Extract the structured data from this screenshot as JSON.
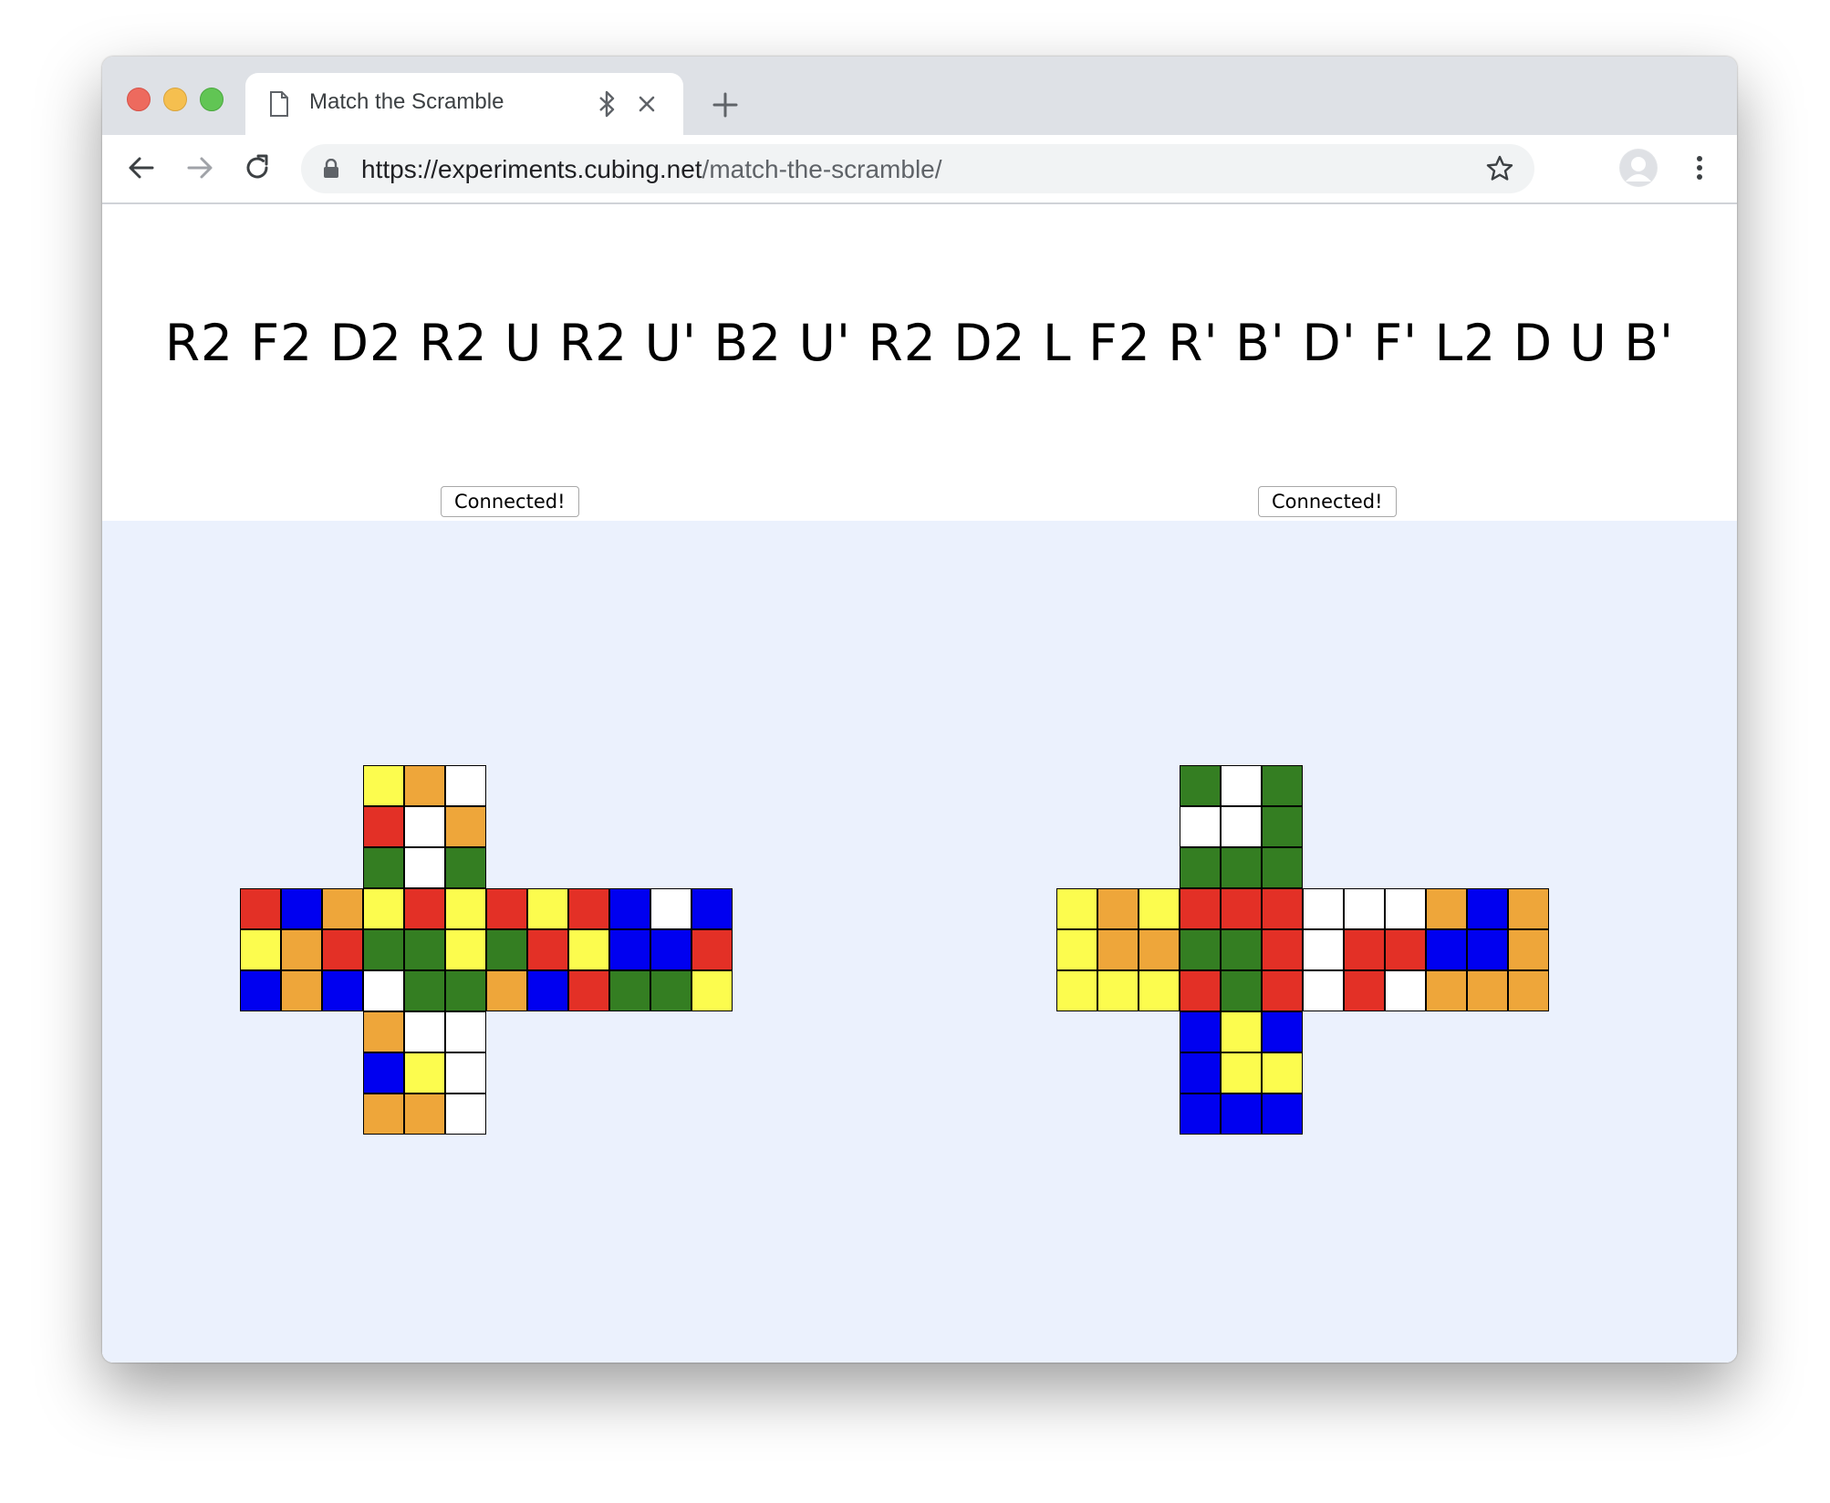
{
  "browser": {
    "tab_title": "Match the Scramble",
    "url_host": "https://experiments.cubing.net",
    "url_path": "/match-the-scramble/"
  },
  "page": {
    "scramble": "R2 F2 D2 R2 U R2 U' B2 U' R2 D2 L F2 R' B' D' F' L2 D U B'",
    "left_button": "Connected!",
    "right_button": "Connected!"
  },
  "colors": {
    "Y": "#fcfc4e",
    "O": "#eea63a",
    "W": "#ffffff",
    "R": "#e33026",
    "G": "#347e22",
    "B": "#0000f0",
    "play_area_bg": "#ebf1fd"
  },
  "cubes": [
    {
      "U": [
        [
          "Y",
          "O",
          "W"
        ],
        [
          "R",
          "W",
          "O"
        ],
        [
          "G",
          "W",
          "G"
        ]
      ],
      "L": [
        [
          "R",
          "B",
          "O"
        ],
        [
          "Y",
          "O",
          "R"
        ],
        [
          "B",
          "O",
          "B"
        ]
      ],
      "F": [
        [
          "Y",
          "R",
          "Y"
        ],
        [
          "G",
          "G",
          "Y"
        ],
        [
          "W",
          "G",
          "G"
        ]
      ],
      "R": [
        [
          "R",
          "Y",
          "R"
        ],
        [
          "G",
          "R",
          "Y"
        ],
        [
          "O",
          "B",
          "R"
        ]
      ],
      "B": [
        [
          "B",
          "W",
          "B"
        ],
        [
          "B",
          "B",
          "R"
        ],
        [
          "G",
          "G",
          "Y"
        ]
      ],
      "D": [
        [
          "O",
          "W",
          "W"
        ],
        [
          "B",
          "Y",
          "W"
        ],
        [
          "O",
          "O",
          "W"
        ]
      ]
    },
    {
      "U": [
        [
          "G",
          "W",
          "G"
        ],
        [
          "W",
          "W",
          "G"
        ],
        [
          "G",
          "G",
          "G"
        ]
      ],
      "L": [
        [
          "Y",
          "O",
          "Y"
        ],
        [
          "Y",
          "O",
          "O"
        ],
        [
          "Y",
          "Y",
          "Y"
        ]
      ],
      "F": [
        [
          "R",
          "R",
          "R"
        ],
        [
          "G",
          "G",
          "R"
        ],
        [
          "R",
          "G",
          "R"
        ]
      ],
      "R": [
        [
          "W",
          "W",
          "W"
        ],
        [
          "W",
          "R",
          "R"
        ],
        [
          "W",
          "R",
          "W"
        ]
      ],
      "B": [
        [
          "O",
          "B",
          "O"
        ],
        [
          "B",
          "B",
          "O"
        ],
        [
          "O",
          "O",
          "O"
        ]
      ],
      "D": [
        [
          "B",
          "Y",
          "B"
        ],
        [
          "B",
          "Y",
          "Y"
        ],
        [
          "B",
          "B",
          "B"
        ]
      ]
    }
  ]
}
